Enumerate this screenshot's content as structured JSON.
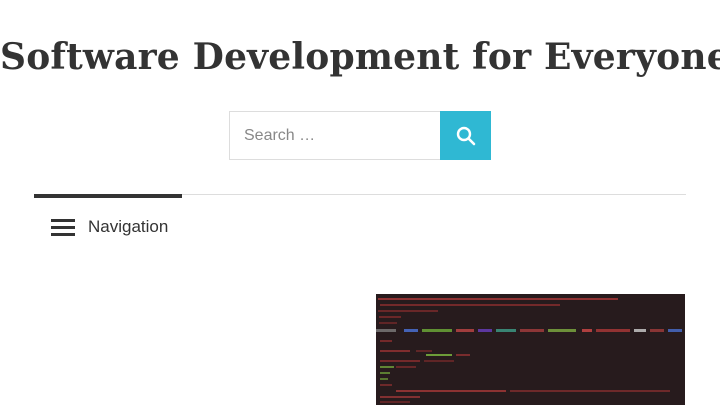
{
  "site": {
    "title": "Software Development for Everyone"
  },
  "search": {
    "placeholder": "Search …",
    "value": "",
    "button_icon": "search-icon",
    "accent_color": "#2fb8d3"
  },
  "navigation": {
    "toggle_label": "Navigation",
    "toggle_icon": "hamburger-menu-icon"
  },
  "featured": {
    "image_description_icon": "code-screenshot-image"
  }
}
